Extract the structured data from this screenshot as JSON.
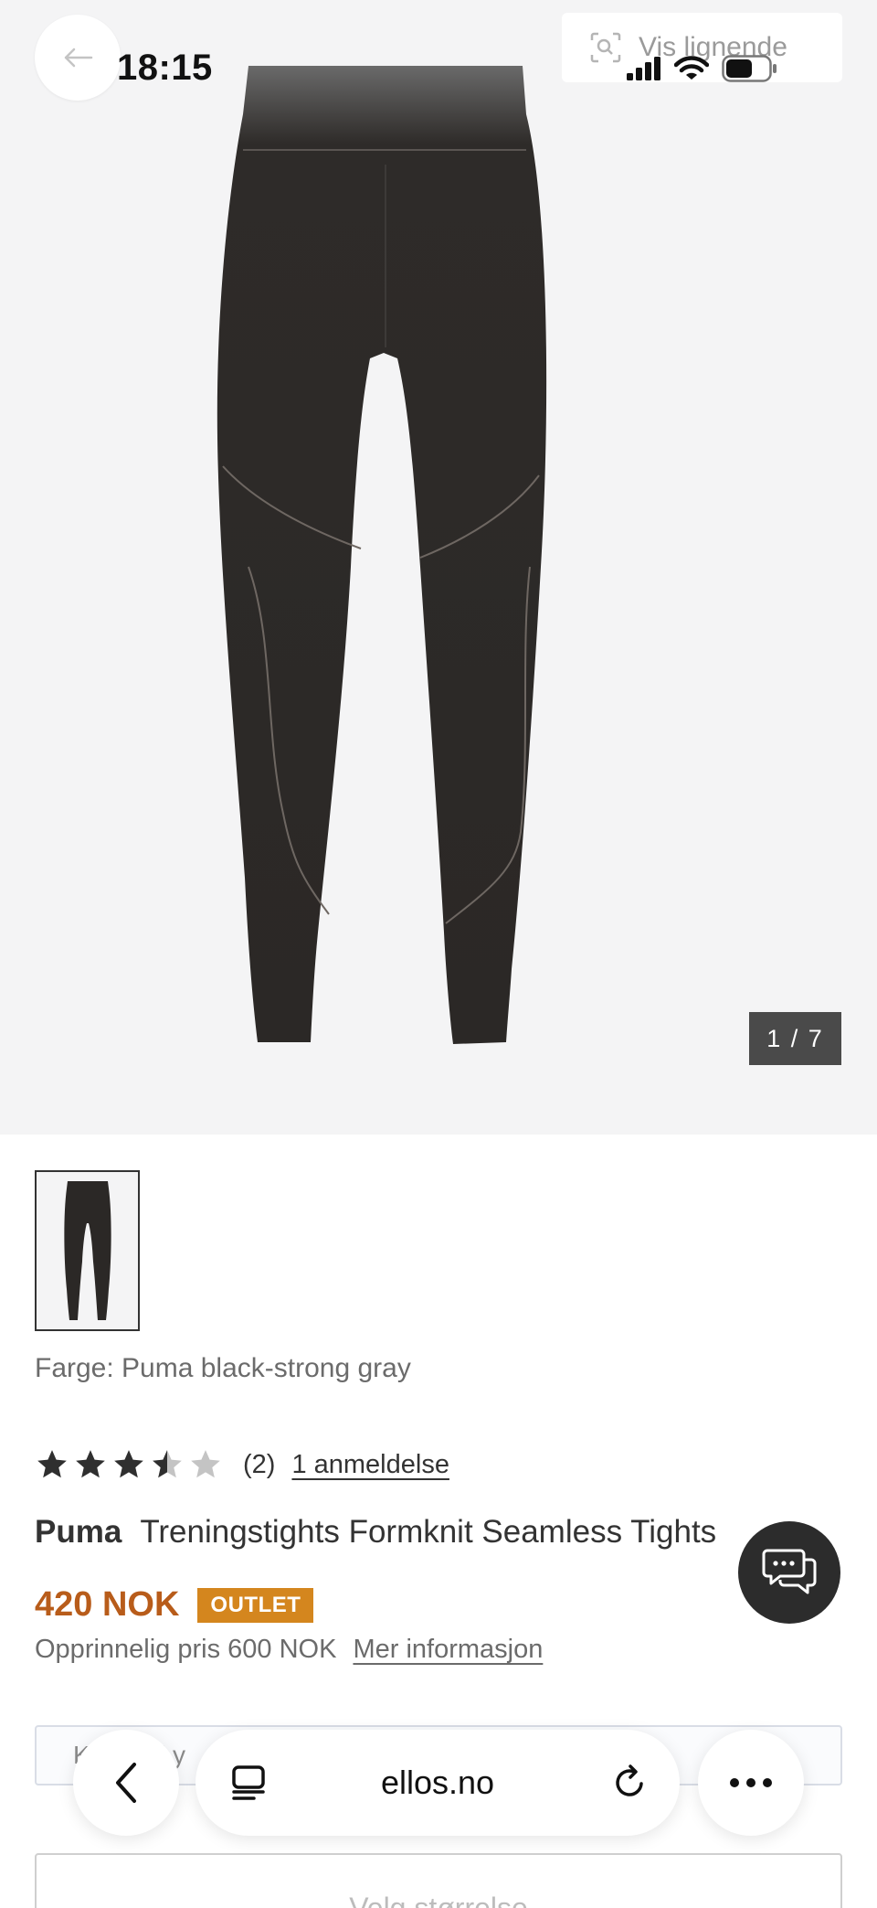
{
  "status_bar": {
    "time": "18:15"
  },
  "header": {
    "similar_label": "Vis lignende"
  },
  "gallery": {
    "counter": "1 / 7"
  },
  "product": {
    "color_line": "Farge: Puma black-strong gray",
    "rating": {
      "value": 3.5,
      "max": 5,
      "count": "(2)",
      "reviews_link": "1 anmeldelse"
    },
    "brand": "Puma",
    "name": "Treningstights Formknit Seamless Tights",
    "price": "420 NOK",
    "badge": "OUTLET",
    "original_price": "Opprinnelig pris 600 NOK",
    "more_info": "Mer informasjon"
  },
  "info_box": {
    "text": "K          bet              ell         y"
  },
  "size_select": {
    "label": "Velg størrelse"
  },
  "browser": {
    "url": "ellos.no"
  },
  "colors": {
    "price": "#b85c1a",
    "badge": "#d4861e",
    "chat": "#2c2c2c"
  }
}
